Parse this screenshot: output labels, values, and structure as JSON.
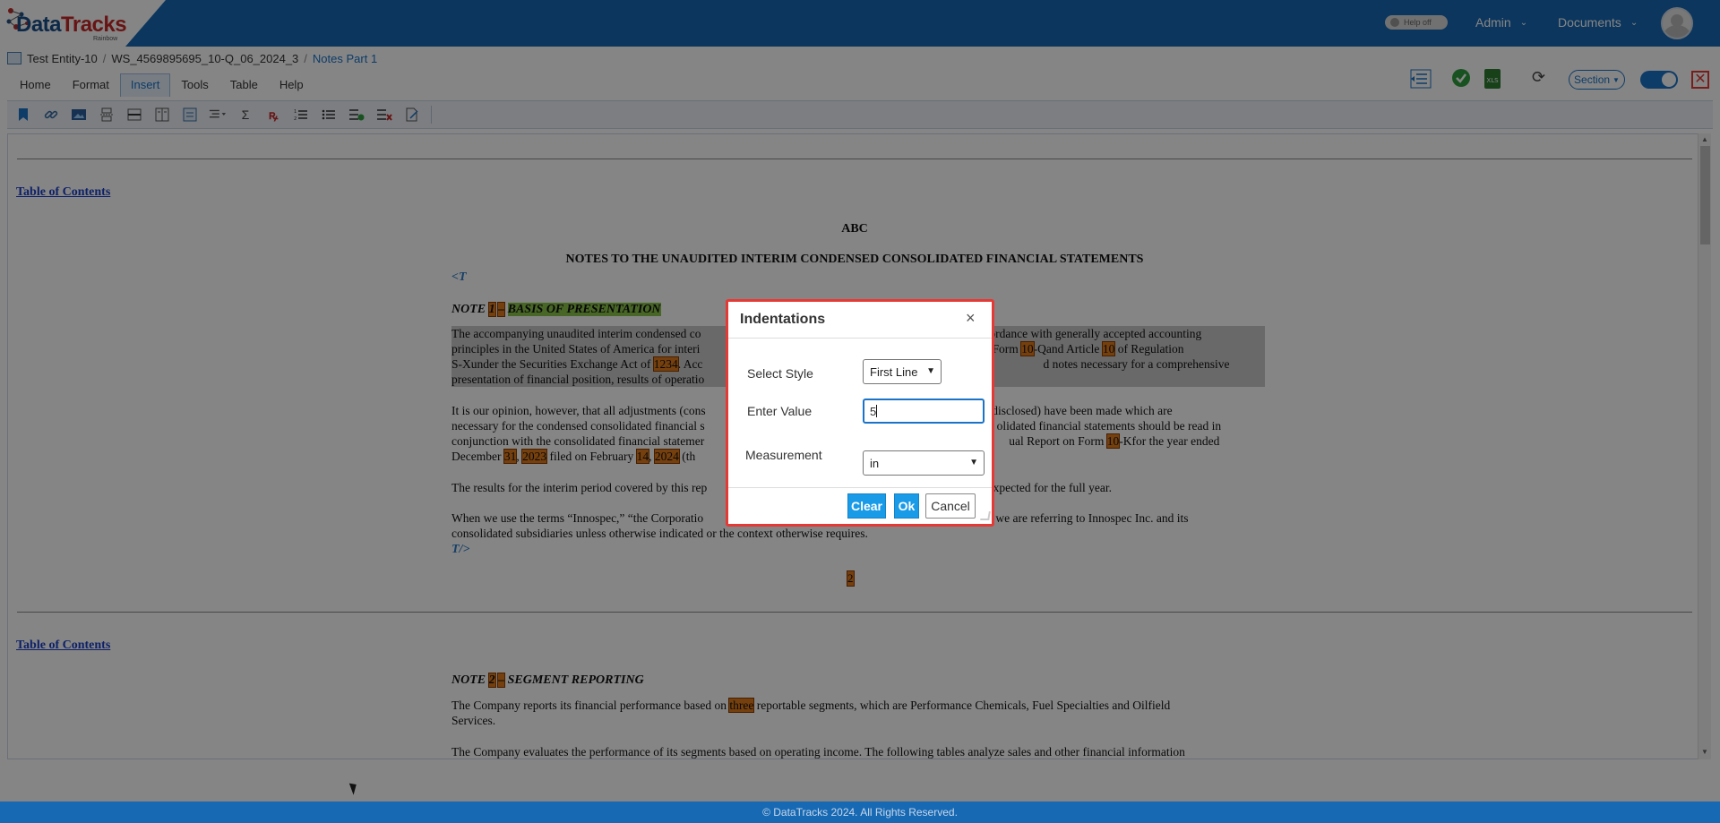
{
  "header": {
    "logo_text_d": "Data",
    "logo_text_t": "Tracks",
    "logo_sub": "Rainbow",
    "help_toggle": "Help off",
    "admin_menu": "Admin",
    "documents_menu": "Documents"
  },
  "breadcrumb": {
    "entity": "Test Entity-10",
    "workspace": "WS_4569895695_10-Q_06_2024_3",
    "separator": "/",
    "current": "Notes Part 1"
  },
  "menu_tabs": [
    "Home",
    "Format",
    "Insert",
    "Tools",
    "Table",
    "Help"
  ],
  "active_tab": "Insert",
  "right_tools": {
    "section_label": "Section"
  },
  "document": {
    "toc_link": "Table of Contents",
    "company": "ABC",
    "heading": "NOTES TO THE UNAUDITED INTERIM CONDENSED CONSOLIDATED FINANCIAL STATEMENTS",
    "tag_open": "<T",
    "tag_close": "T/>",
    "note1_prefix": "NOTE",
    "note1_num": "1",
    "note1_dash": "–",
    "note1_title": "BASIS OF PRESENTATION",
    "p1_l1a": "The accompanying unaudited interim condensed co",
    "p1_l1b": "in accordance with generally accepted accounting",
    "p1_l2a": "principles in the United States of America for interi",
    "p1_l2b": "Form",
    "p1_l2c": "10",
    "p1_l2d": "-Qand Article",
    "p1_l2e": "10",
    "p1_l2f": "of Regulation",
    "p1_l3a": "S-Xunder the Securities Exchange Act of",
    "p1_l3b": "1234",
    "p1_l3c": ". Acc",
    "p1_l3d": "d notes necessary for a comprehensive",
    "p1_l4": "presentation of financial position, results of operatio",
    "p2_l1a": "It is our opinion, however, that all adjustments (cons",
    "p2_l1b": "rwise disclosed) have been made which are",
    "p2_l2a": "necessary for the condensed consolidated financial s",
    "p2_l2b": "olidated financial statements should be read in",
    "p2_l3a": "conjunction with the consolidated financial statemer",
    "p2_l3b": "ual Report on Form",
    "p2_l3c": "10",
    "p2_l3d": "-Kfor the year ended",
    "p2_l4a": "December",
    "p2_l4b": "31",
    "p2_l4c": ",",
    "p2_l4d": "2023",
    "p2_l4e": "filed on February",
    "p2_l4f": "14",
    "p2_l4g": ",",
    "p2_l4h": "2024",
    "p2_l4i": "(th",
    "p3a": "The results for the interim period covered by this rep",
    "p3b": "e expected for the full year.",
    "p4_l1a": "When we use the terms “Innospec,” “the Corporatio",
    "p4_l1b": "our,” we are referring to Innospec Inc. and its",
    "p4_l2": "consolidated subsidiaries unless otherwise indicated or the context otherwise requires.",
    "page_num": "2",
    "toc_link2": "Table of Contents",
    "note2_prefix": "NOTE",
    "note2_num": "2",
    "note2_dash": "–",
    "note2_title": "SEGMENT REPORTING",
    "p5_l1a": "The Company reports its financial performance based on",
    "p5_l1b": "three",
    "p5_l1c": "reportable segments, which are Performance Chemicals, Fuel Specialties and Oilfield",
    "p5_l2": "Services.",
    "p6": "The Company evaluates the performance of its segments based on operating income. The following tables analyze sales and other financial information"
  },
  "dialog": {
    "title": "Indentations",
    "close": "×",
    "style_label": "Select Style",
    "style_value": "First Line",
    "value_label": "Enter Value",
    "value": "5",
    "measurement_label": "Measurement",
    "measurement_value": "in",
    "clear": "Clear",
    "ok": "Ok",
    "cancel": "Cancel"
  },
  "footer": {
    "copyright": "© DataTracks 2024. All Rights Reserved."
  },
  "colors": {
    "header_blue": "#1769b3",
    "accent_blue": "#1a9be8",
    "dialog_border": "#e53935",
    "highlight_orange": "#e07b1a",
    "highlight_green": "#8bc34a"
  }
}
